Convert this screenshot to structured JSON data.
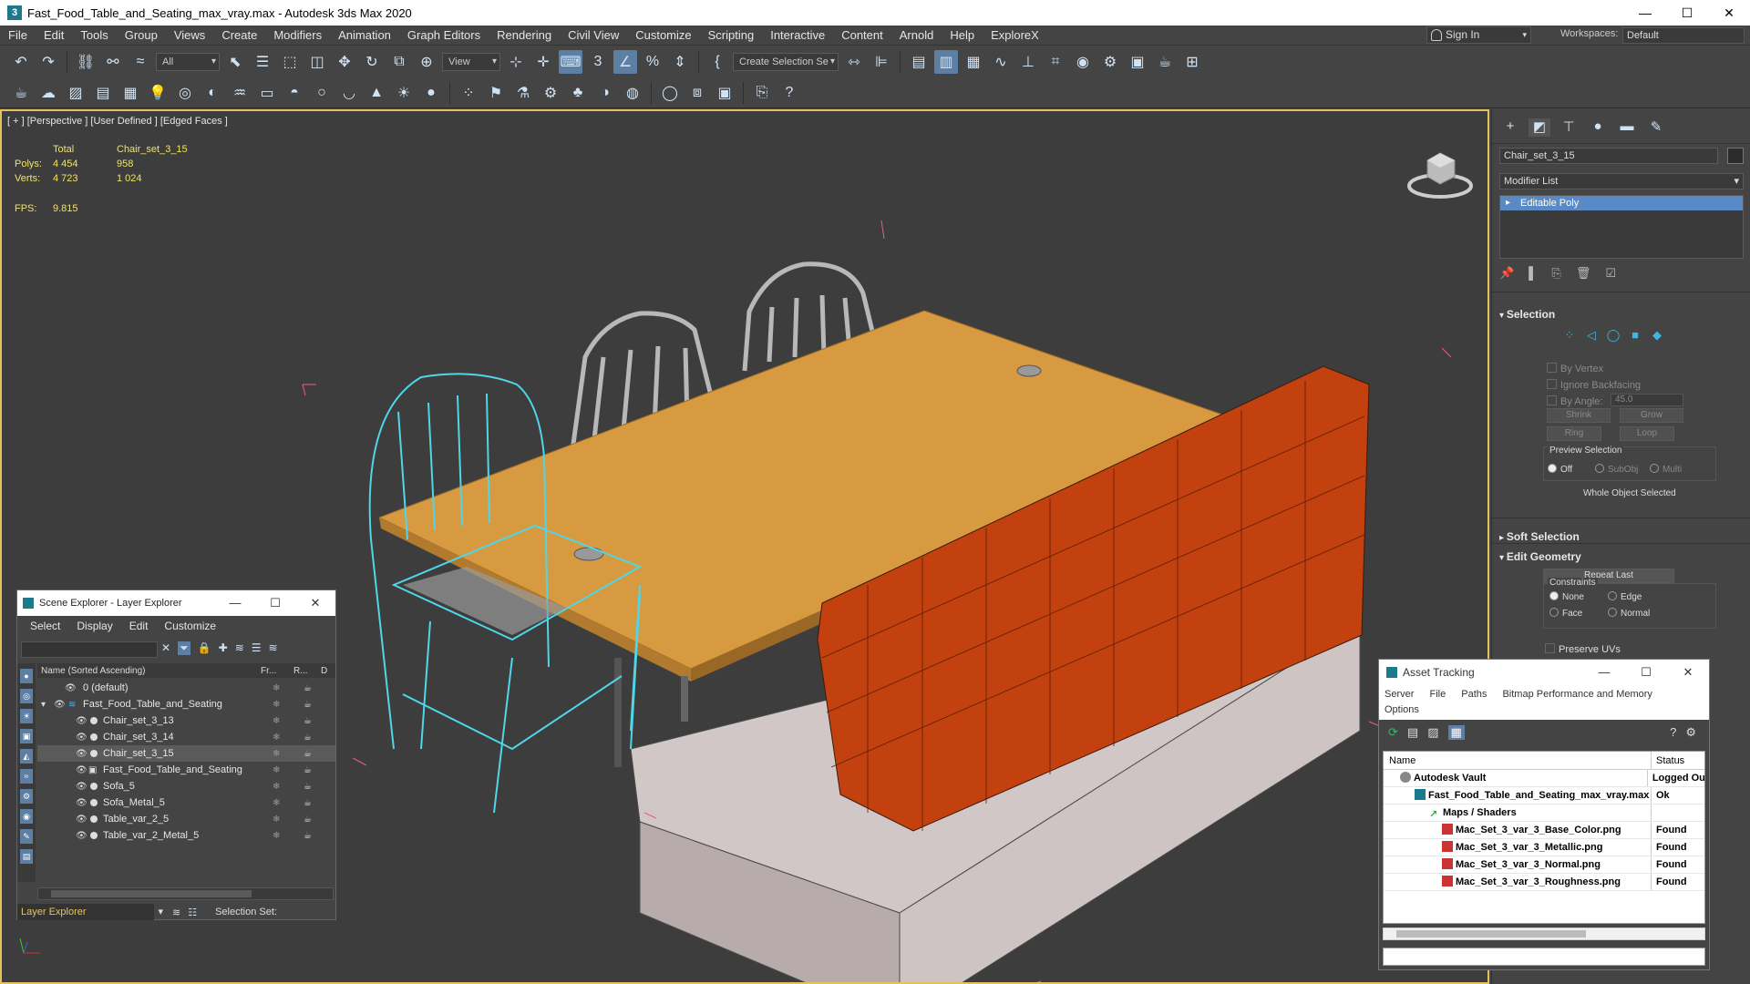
{
  "window": {
    "title": "Fast_Food_Table_and_Seating_max_vray.max - Autodesk 3ds Max 2020",
    "app_icon": "3",
    "minimize": "—",
    "maximize": "☐",
    "close": "✕"
  },
  "menu": {
    "items": [
      "File",
      "Edit",
      "Tools",
      "Group",
      "Views",
      "Create",
      "Modifiers",
      "Animation",
      "Graph Editors",
      "Rendering",
      "Civil View",
      "Customize",
      "Scripting",
      "Interactive",
      "Content",
      "Arnold",
      "Help",
      "ExploreX"
    ],
    "sign_in": "Sign In",
    "workspaces_label": "Workspaces:",
    "workspace_value": "Default"
  },
  "toolbar": {
    "filter_value": "All",
    "view_value": "View",
    "selection_set_placeholder": "Create Selection Se",
    "icons_row1": [
      "undo-icon",
      "redo-icon",
      "link-icon",
      "unlink-icon",
      "bind-spacewarp-icon",
      "select-object-icon",
      "select-by-name-icon",
      "rect-selection-icon",
      "window-crossing-icon",
      "move-icon",
      "rotate-icon",
      "scale-icon",
      "placement-icon",
      "select-manipulate-icon",
      "snap-toggle-icon",
      "angle-snap-icon",
      "percent-snap-icon",
      "spinner-snap-icon",
      "edit-named-sets-icon",
      "mirror-icon",
      "align-icon",
      "layer-explorer-icon",
      "ribbon-icon",
      "curve-editor-icon",
      "schematic-icon",
      "material-editor-icon",
      "render-setup-icon",
      "render-frame-icon",
      "render-icon",
      "render-iterative-icon"
    ],
    "icons_row2_count": 30
  },
  "viewport": {
    "label": "[ + ] [Perspective ] [User Defined ] [Edged Faces ]",
    "stats": {
      "col_total": "Total",
      "col_object": "Chair_set_3_15",
      "polys_label": "Polys:",
      "polys_total": "4 454",
      "polys_object": "958",
      "verts_label": "Verts:",
      "verts_total": "4 723",
      "verts_object": "1 024",
      "fps_label": "FPS:",
      "fps_value": "9.815"
    }
  },
  "command_panel": {
    "object_name": "Chair_set_3_15",
    "modifier_list": "Modifier List",
    "stack_item": "Editable Poly",
    "selection_title": "Selection",
    "by_vertex": "By Vertex",
    "ignore_backfacing": "Ignore Backfacing",
    "by_angle": "By Angle:",
    "by_angle_value": "45.0",
    "shrink": "Shrink",
    "grow": "Grow",
    "ring": "Ring",
    "loop": "Loop",
    "preview_selection": "Preview Selection",
    "preview_off": "Off",
    "preview_subobj": "SubObj",
    "preview_multi": "Multi",
    "whole_object_selected": "Whole Object Selected",
    "soft_selection_title": "Soft Selection",
    "edit_geometry_title": "Edit Geometry",
    "repeat_last": "Repeat Last",
    "constraints": "Constraints",
    "c_none": "None",
    "c_edge": "Edge",
    "c_face": "Face",
    "c_normal": "Normal",
    "preserve_uvs": "Preserve UVs"
  },
  "scene_explorer": {
    "title": "Scene Explorer - Layer Explorer",
    "menu": [
      "Select",
      "Display",
      "Edit",
      "Customize"
    ],
    "col_name": "Name (Sorted Ascending)",
    "col_fr": "Fr...",
    "col_r": "R...",
    "col_d": "D",
    "rows": [
      {
        "name": "0 (default)",
        "level": 0
      },
      {
        "name": "Fast_Food_Table_and_Seating",
        "level": 0
      },
      {
        "name": "Chair_set_3_13",
        "level": 1
      },
      {
        "name": "Chair_set_3_14",
        "level": 1
      },
      {
        "name": "Chair_set_3_15",
        "level": 1
      },
      {
        "name": "Fast_Food_Table_and_Seating",
        "level": 1
      },
      {
        "name": "Sofa_5",
        "level": 1
      },
      {
        "name": "Sofa_Metal_5",
        "level": 1
      },
      {
        "name": "Table_var_2_5",
        "level": 1
      },
      {
        "name": "Table_var_2_Metal_5",
        "level": 1
      }
    ],
    "footer_mode": "Layer Explorer",
    "footer_selection_set": "Selection Set:"
  },
  "asset_tracking": {
    "title": "Asset Tracking",
    "menu": [
      "Server",
      "File",
      "Paths",
      "Bitmap Performance and Memory",
      "Options"
    ],
    "col_name": "Name",
    "col_status": "Status",
    "rows": [
      {
        "name": "Autodesk Vault",
        "status": "Logged Ou",
        "indent": 18,
        "icon": "vault"
      },
      {
        "name": "Fast_Food_Table_and_Seating_max_vray.max",
        "status": "Ok",
        "indent": 34,
        "icon": "max"
      },
      {
        "name": "Maps / Shaders",
        "status": "",
        "indent": 50,
        "icon": "maps"
      },
      {
        "name": "Mac_Set_3_var_3_Base_Color.png",
        "status": "Found",
        "indent": 70,
        "icon": "png"
      },
      {
        "name": "Mac_Set_3_var_3_Metallic.png",
        "status": "Found",
        "indent": 70,
        "icon": "png"
      },
      {
        "name": "Mac_Set_3_var_3_Normal.png",
        "status": "Found",
        "indent": 70,
        "icon": "png"
      },
      {
        "name": "Mac_Set_3_var_3_Roughness.png",
        "status": "Found",
        "indent": 70,
        "icon": "png"
      }
    ]
  }
}
